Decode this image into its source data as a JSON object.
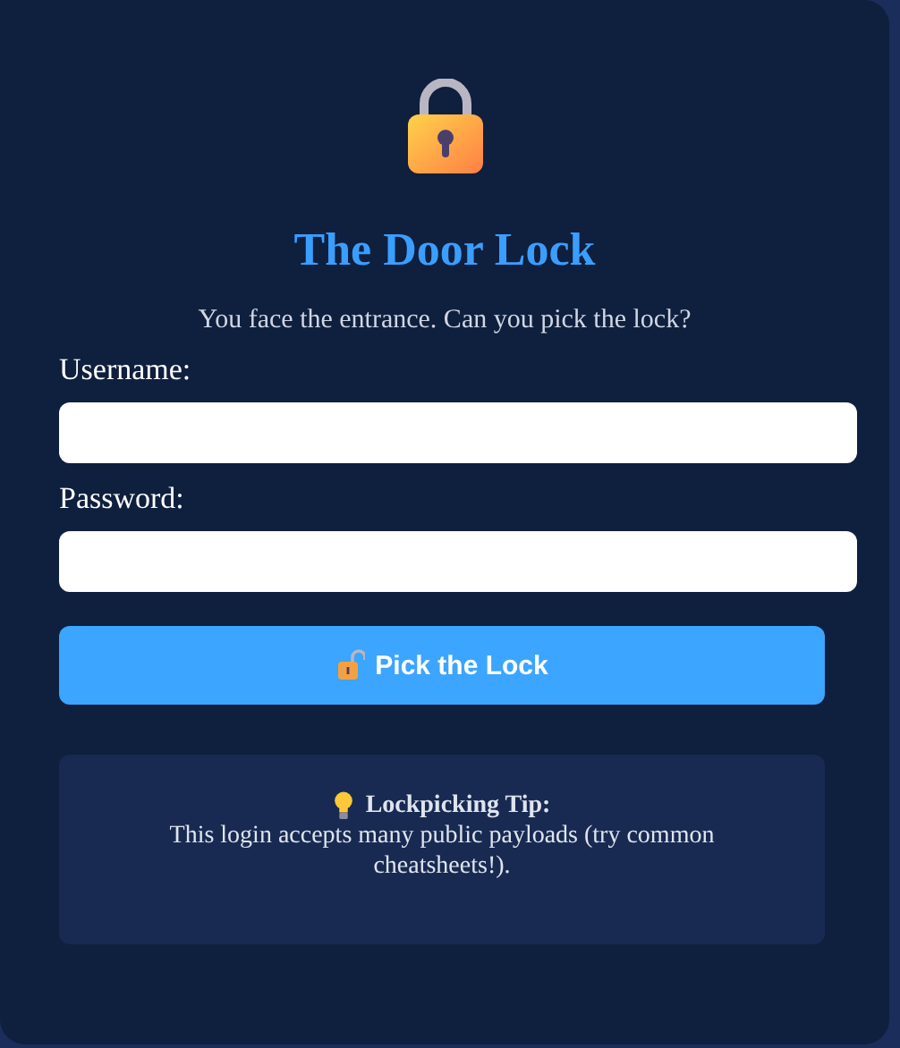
{
  "title": "The Door Lock",
  "subtitle": "You face the entrance. Can you pick the lock?",
  "fields": [
    {
      "label": "Username:"
    },
    {
      "label": "Password:"
    }
  ],
  "button": {
    "label": "Pick the Lock"
  },
  "tip": {
    "heading": "Lockpicking Tip:",
    "text": "This login accepts many public payloads (try common cheatsheets!)."
  }
}
